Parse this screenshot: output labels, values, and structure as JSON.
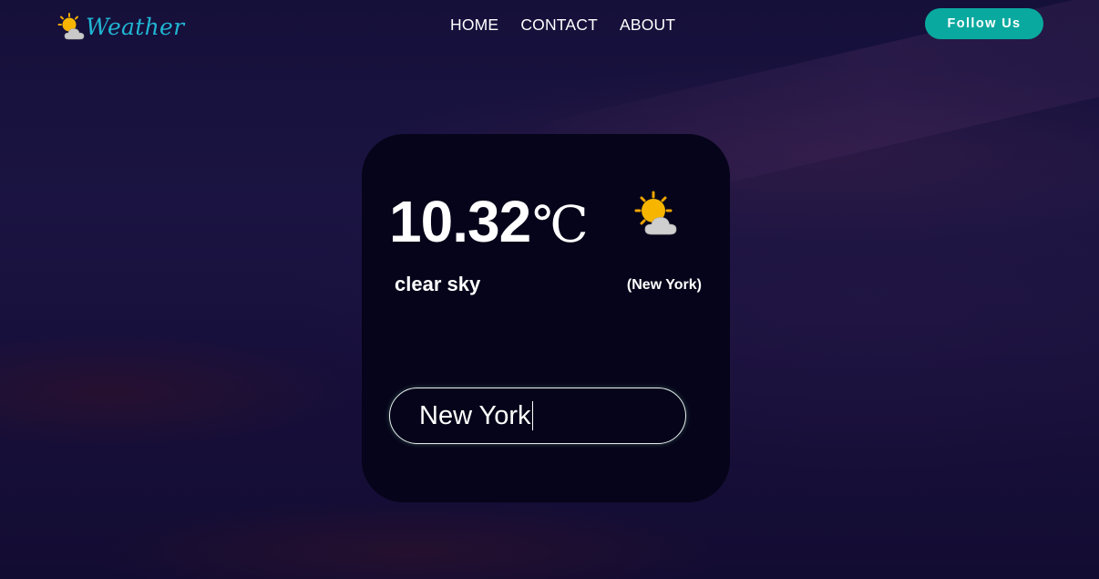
{
  "app": {
    "logo_text": "Weather",
    "logo_icon": "sun-behind-cloud-icon"
  },
  "nav": {
    "items": [
      {
        "label": "HOME"
      },
      {
        "label": "CONTACT"
      },
      {
        "label": "ABOUT"
      }
    ],
    "follow_label": "Follow Us"
  },
  "weather": {
    "temperature": "10.32",
    "unit": "℃",
    "condition_icon": "sun-behind-cloud-icon",
    "description": "clear sky",
    "city": "(New York)"
  },
  "search": {
    "value": "New York"
  },
  "colors": {
    "accent": "#0aa99f",
    "logo": "#20b6d3",
    "card": "#06041a",
    "background": "#1a1340"
  }
}
